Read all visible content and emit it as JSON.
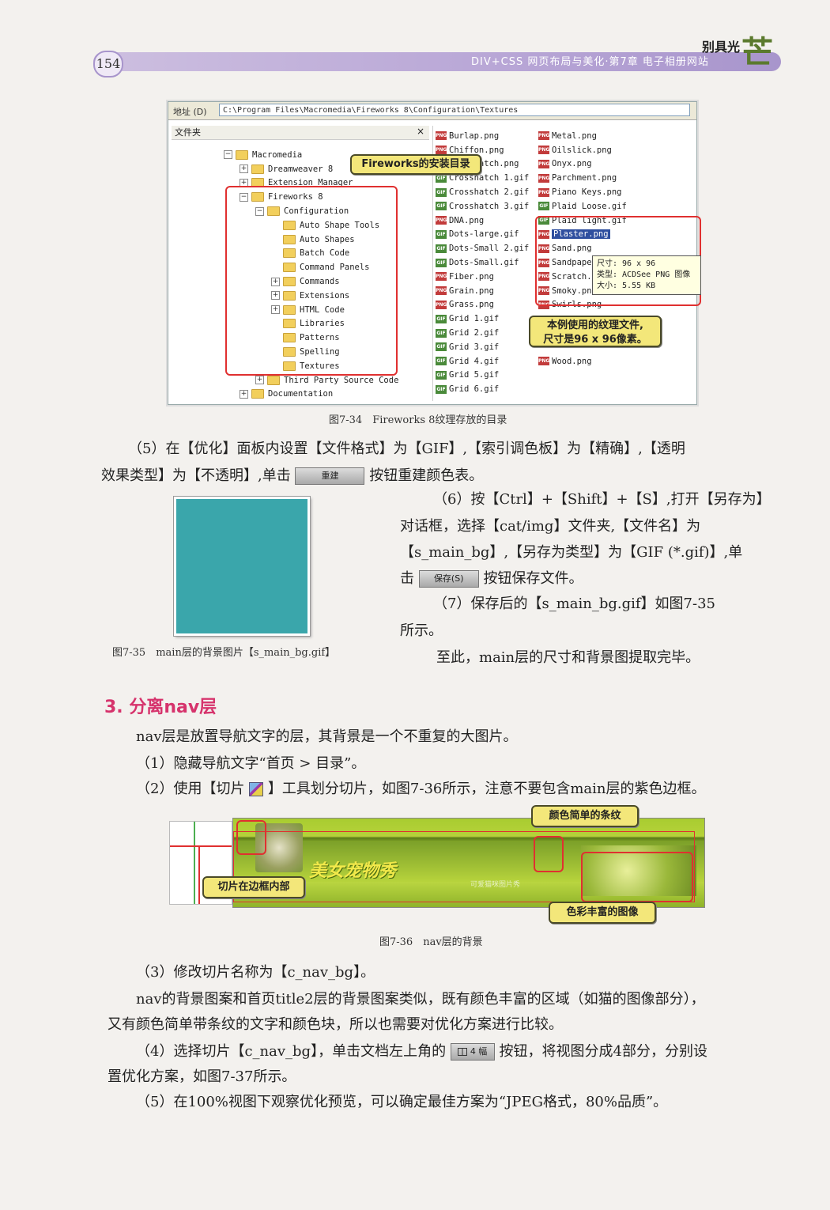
{
  "header": {
    "page_number": "154",
    "running_title": "DIV+CSS 网页布局与美化·第7章  电子相册网站",
    "brand": "别具光",
    "brand_mark": "芒"
  },
  "fig34": {
    "address_label": "地址 (D)",
    "address_path": "C:\\Program Files\\Macromedia\\Fireworks 8\\Configuration\\Textures",
    "folders_header": "文件夹",
    "tree": [
      {
        "pm": "−",
        "indent": 0,
        "label": "Macromedia"
      },
      {
        "pm": "+",
        "indent": 1,
        "label": "Dreamweaver 8"
      },
      {
        "pm": "+",
        "indent": 1,
        "label": "Extension Manager"
      },
      {
        "pm": "−",
        "indent": 1,
        "label": "Fireworks 8"
      },
      {
        "pm": "−",
        "indent": 2,
        "label": "Configuration"
      },
      {
        "pm": "",
        "indent": 3,
        "label": "Auto Shape Tools"
      },
      {
        "pm": "",
        "indent": 3,
        "label": "Auto Shapes"
      },
      {
        "pm": "",
        "indent": 3,
        "label": "Batch Code"
      },
      {
        "pm": "",
        "indent": 3,
        "label": "Command Panels"
      },
      {
        "pm": "+",
        "indent": 3,
        "label": "Commands"
      },
      {
        "pm": "+",
        "indent": 3,
        "label": "Extensions"
      },
      {
        "pm": "+",
        "indent": 3,
        "label": "HTML Code"
      },
      {
        "pm": "",
        "indent": 3,
        "label": "Libraries"
      },
      {
        "pm": "",
        "indent": 3,
        "label": "Patterns"
      },
      {
        "pm": "",
        "indent": 3,
        "label": "Spelling"
      },
      {
        "pm": "",
        "indent": 3,
        "label": "Textures"
      },
      {
        "pm": "+",
        "indent": 2,
        "label": "Third Party Source Code"
      },
      {
        "pm": "+",
        "indent": 1,
        "label": "Documentation"
      }
    ],
    "files_col1": [
      {
        "t": "png",
        "n": "Burlap.png"
      },
      {
        "t": "png",
        "n": "Chiffon.png"
      },
      {
        "t": "png",
        "n": "Crosshatch.png"
      },
      {
        "t": "gif",
        "n": "Crosshatch 1.gif"
      },
      {
        "t": "gif",
        "n": "Crosshatch 2.gif"
      },
      {
        "t": "gif",
        "n": "Crosshatch 3.gif"
      },
      {
        "t": "png",
        "n": "DNA.png"
      },
      {
        "t": "gif",
        "n": "Dots-large.gif"
      },
      {
        "t": "gif",
        "n": "Dots-Small 2.gif"
      },
      {
        "t": "gif",
        "n": "Dots-Small.gif"
      },
      {
        "t": "png",
        "n": "Fiber.png"
      },
      {
        "t": "png",
        "n": "Grain.png"
      },
      {
        "t": "png",
        "n": "Grass.png"
      },
      {
        "t": "gif",
        "n": "Grid 1.gif"
      },
      {
        "t": "gif",
        "n": "Grid 2.gif"
      },
      {
        "t": "gif",
        "n": "Grid 3.gif"
      },
      {
        "t": "gif",
        "n": "Grid 4.gif"
      },
      {
        "t": "gif",
        "n": "Grid 5.gif"
      },
      {
        "t": "gif",
        "n": "Grid 6.gif"
      }
    ],
    "files_col2": [
      {
        "t": "png",
        "n": "Metal.png"
      },
      {
        "t": "png",
        "n": "Oilslick.png"
      },
      {
        "t": "png",
        "n": "Onyx.png"
      },
      {
        "t": "png",
        "n": "Parchment.png"
      },
      {
        "t": "png",
        "n": "Piano Keys.png"
      },
      {
        "t": "gif",
        "n": "Plaid Loose.gif"
      },
      {
        "t": "gif",
        "n": "Plaid light.gif"
      },
      {
        "t": "png",
        "n": "Plaster.png",
        "selected": true
      },
      {
        "t": "png",
        "n": "Sand.png"
      },
      {
        "t": "png",
        "n": "Sandpaper.png"
      },
      {
        "t": "png",
        "n": "Scratch.png"
      },
      {
        "t": "png",
        "n": "Smoky.png"
      },
      {
        "t": "png",
        "n": "Swirls.png"
      },
      {
        "t": "",
        "n": ""
      },
      {
        "t": "",
        "n": ""
      },
      {
        "t": "",
        "n": ""
      },
      {
        "t": "png",
        "n": "Wood.png"
      }
    ],
    "tooltip": [
      "尺寸: 96 x 96",
      "类型: ACDSee PNG 图像",
      "大小: 5.55 KB"
    ],
    "callout_install": "Fireworks的安装目录",
    "callout_texture_1": "本例使用的纹理文件,",
    "callout_texture_2": "尺寸是96 x 96像素。",
    "caption": "图7-34　Fireworks 8纹理存放的目录"
  },
  "body": {
    "p5_a": "（5）在【优化】面板内设置【文件格式】为【GIF】,【索引调色板】为【精确】,【透明",
    "p5_b1": "效果类型】为【不透明】,单击",
    "btn_rebuild": "重建",
    "p5_b2": "按钮重建颜色表。",
    "p6_a": "（6）按【Ctrl】+【Shift】+【S】,打开【另存为】",
    "p6_b": "对话框，选择【cat/img】文件夹,【文件名】为",
    "p6_c": "【s_main_bg】,【另存为类型】为【GIF (*.gif)】,单",
    "p6_d1": "击",
    "btn_save": "保存(S)",
    "p6_d2": "按钮保存文件。",
    "p7_a": "（7）保存后的【s_main_bg.gif】如图7-35",
    "p7_b": "所示。",
    "p_done": "至此，main层的尺寸和背景图提取完毕。",
    "fig35_caption": "图7-35　main层的背景图片【s_main_bg.gif】",
    "section_title": "3. 分离nav层",
    "nav_intro": "nav层是放置导航文字的层，其背景是一个不重复的大图片。",
    "nav_1": "（1）隐藏导航文字“首页 > 目录”。",
    "nav_2a": "（2）使用【切片",
    "nav_2b": "】工具划分切片，如图7-36所示，注意不要包含main层的紫色边框。",
    "nav_3": "（3）修改切片名称为【c_nav_bg】。",
    "nav_p1": "nav的背景图案和首页title2层的背景图案类似，既有颜色丰富的区域（如猫的图像部分），",
    "nav_p2": "又有颜色简单带条纹的文字和颜色块，所以也需要对优化方案进行比较。",
    "nav_4a": "（4）选择切片【c_nav_bg】，单击文档左上角的",
    "btn_4up": "4 幅",
    "nav_4b": "按钮，将视图分成4部分，分别设",
    "nav_4c": "置优化方案，如图7-37所示。",
    "nav_5": "（5）在100%视图下观察优化预览，可以确定最佳方案为“JPEG格式，80%品质”。"
  },
  "fig36": {
    "banner_title": "美女宠物秀",
    "banner_sub": "可爱猫咪图片秀",
    "callout_simple": "颜色简单的条纹",
    "callout_inside": "切片在边框内部",
    "callout_rich": "色彩丰富的图像",
    "caption": "图7-36　nav层的背景"
  },
  "colors": {
    "accent_pink": "#d6336c",
    "callout_yellow": "#f3e77a",
    "highlight_red": "#e03030",
    "teal_texture": "#3aa6ab"
  }
}
